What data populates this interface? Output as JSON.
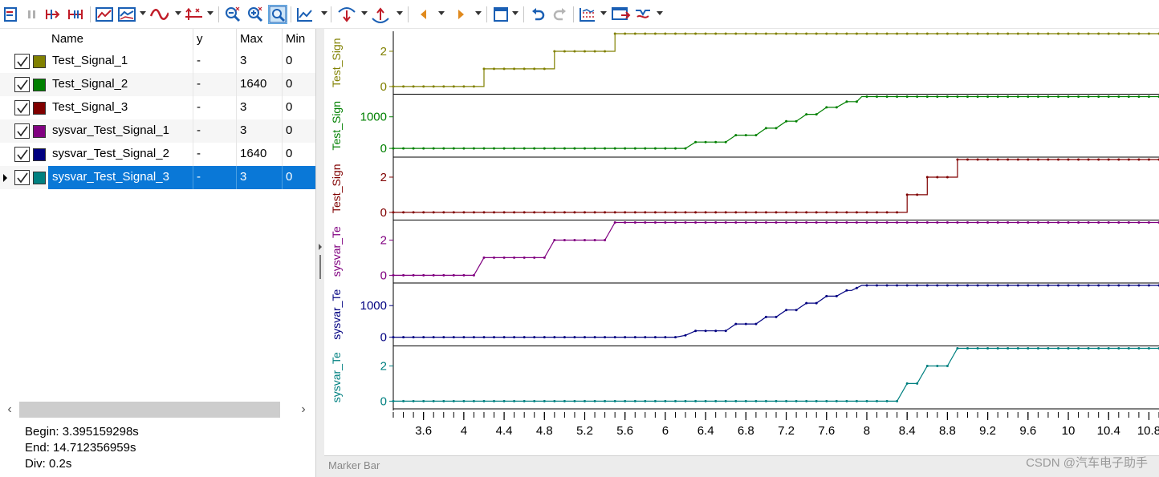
{
  "toolbar": {
    "icons": [
      "signal-list-icon",
      "pause-icon",
      "cursor-left-icon",
      "cursor-both-icon",
      "chart-view-icon",
      "chart-style-icon",
      "wave-icon",
      "axis-xy-icon",
      "zoom-out-icon",
      "zoom-in-icon",
      "zoom-fit-icon",
      "line-chart-icon",
      "step-up-icon",
      "step-down-icon",
      "prev-marker-icon",
      "next-marker-icon",
      "window-icon",
      "undo-icon",
      "redo-icon",
      "measure-icon",
      "export-icon",
      "sync-icon"
    ]
  },
  "grid": {
    "headers": {
      "name": "Name",
      "y": "y",
      "max": "Max",
      "min": "Min"
    },
    "rows": [
      {
        "name": "Test_Signal_1",
        "y": "-",
        "max": "3",
        "min": "0",
        "color": "#808000",
        "checked": true
      },
      {
        "name": "Test_Signal_2",
        "y": "-",
        "max": "1640",
        "min": "0",
        "color": "#008000",
        "checked": true
      },
      {
        "name": "Test_Signal_3",
        "y": "-",
        "max": "3",
        "min": "0",
        "color": "#800000",
        "checked": true
      },
      {
        "name": "sysvar_Test_Signal_1",
        "y": "-",
        "max": "3",
        "min": "0",
        "color": "#800080",
        "checked": true
      },
      {
        "name": "sysvar_Test_Signal_2",
        "y": "-",
        "max": "1640",
        "min": "0",
        "color": "#000080",
        "checked": true
      },
      {
        "name": "sysvar_Test_Signal_3",
        "y": "-",
        "max": "3",
        "min": "0",
        "color": "#008080",
        "checked": true,
        "selected": true
      }
    ]
  },
  "info": {
    "begin": "Begin: 3.395159298s",
    "end": "End: 14.712356959s",
    "div": "Div: 0.2s"
  },
  "marker_bar": "Marker Bar",
  "watermark": "CSDN @汽车电子助手",
  "chart_data": {
    "type": "line",
    "step": true,
    "x_range": [
      3.3,
      10.9
    ],
    "x_ticks": [
      "3.6",
      "4",
      "4.4",
      "4.8",
      "5.2",
      "5.6",
      "6",
      "6.4",
      "6.8",
      "7.2",
      "7.6",
      "8",
      "8.4",
      "8.8",
      "9.2",
      "9.6",
      "10",
      "10.4",
      "10.8"
    ],
    "x_tick_values": [
      3.6,
      4,
      4.4,
      4.8,
      5.2,
      5.6,
      6,
      6.4,
      6.8,
      7.2,
      7.6,
      8,
      8.4,
      8.8,
      9.2,
      9.6,
      10,
      10.4,
      10.8
    ],
    "sample_step": 0.1,
    "panels": [
      {
        "label": "Test_Sign",
        "color": "#808000",
        "ylim": [
          -0.3,
          3
        ],
        "y_ticks": [
          "0",
          "2"
        ],
        "y_tick_values": [
          0,
          2
        ],
        "interp": "step",
        "points": [
          [
            3.3,
            0
          ],
          [
            4.2,
            0
          ],
          [
            4.2,
            1
          ],
          [
            4.9,
            1
          ],
          [
            4.9,
            2
          ],
          [
            5.5,
            2
          ],
          [
            5.5,
            3
          ],
          [
            10.9,
            3
          ]
        ]
      },
      {
        "label": "Test_Sign",
        "color": "#008000",
        "ylim": [
          -200,
          1640
        ],
        "y_ticks": [
          "0",
          "1000"
        ],
        "y_tick_values": [
          0,
          1000
        ],
        "interp": "step",
        "points": [
          [
            3.3,
            0
          ],
          [
            6.2,
            0
          ],
          [
            6.3,
            200
          ],
          [
            6.6,
            200
          ],
          [
            6.7,
            420
          ],
          [
            6.9,
            420
          ],
          [
            7.0,
            640
          ],
          [
            7.1,
            640
          ],
          [
            7.2,
            860
          ],
          [
            7.3,
            860
          ],
          [
            7.4,
            1080
          ],
          [
            7.5,
            1080
          ],
          [
            7.6,
            1300
          ],
          [
            7.7,
            1300
          ],
          [
            7.8,
            1480
          ],
          [
            7.9,
            1480
          ],
          [
            7.95,
            1640
          ],
          [
            10.9,
            1640
          ]
        ]
      },
      {
        "label": "Test_Sign",
        "color": "#800000",
        "ylim": [
          -0.3,
          3
        ],
        "y_ticks": [
          "0",
          "2"
        ],
        "y_tick_values": [
          0,
          2
        ],
        "interp": "step",
        "points": [
          [
            3.3,
            0
          ],
          [
            8.4,
            0
          ],
          [
            8.4,
            1
          ],
          [
            8.6,
            1
          ],
          [
            8.6,
            2
          ],
          [
            8.9,
            2
          ],
          [
            8.9,
            3
          ],
          [
            10.9,
            3
          ]
        ]
      },
      {
        "label": "sysvar_Te",
        "color": "#800080",
        "ylim": [
          -0.3,
          3
        ],
        "y_ticks": [
          "0",
          "2"
        ],
        "y_tick_values": [
          0,
          2
        ],
        "interp": "linear",
        "points": [
          [
            3.3,
            0
          ],
          [
            4.1,
            0
          ],
          [
            4.2,
            1
          ],
          [
            4.8,
            1
          ],
          [
            4.9,
            2
          ],
          [
            5.4,
            2
          ],
          [
            5.5,
            3
          ],
          [
            10.9,
            3
          ]
        ]
      },
      {
        "label": "sysvar_Te",
        "color": "#000080",
        "ylim": [
          -200,
          1640
        ],
        "y_ticks": [
          "0",
          "1000"
        ],
        "y_tick_values": [
          0,
          1000
        ],
        "interp": "linear",
        "points": [
          [
            3.3,
            0
          ],
          [
            6.1,
            0
          ],
          [
            6.2,
            60
          ],
          [
            6.3,
            200
          ],
          [
            6.6,
            200
          ],
          [
            6.7,
            420
          ],
          [
            6.9,
            420
          ],
          [
            7.0,
            640
          ],
          [
            7.1,
            640
          ],
          [
            7.2,
            860
          ],
          [
            7.3,
            860
          ],
          [
            7.4,
            1080
          ],
          [
            7.5,
            1080
          ],
          [
            7.6,
            1300
          ],
          [
            7.7,
            1300
          ],
          [
            7.8,
            1480
          ],
          [
            7.85,
            1480
          ],
          [
            7.95,
            1640
          ],
          [
            10.9,
            1640
          ]
        ]
      },
      {
        "label": "sysvar_Te",
        "color": "#008080",
        "ylim": [
          -0.3,
          3
        ],
        "y_ticks": [
          "0",
          "2"
        ],
        "y_tick_values": [
          0,
          2
        ],
        "interp": "linear",
        "points": [
          [
            3.3,
            0
          ],
          [
            8.3,
            0
          ],
          [
            8.4,
            1
          ],
          [
            8.5,
            1
          ],
          [
            8.6,
            2
          ],
          [
            8.8,
            2
          ],
          [
            8.9,
            3
          ],
          [
            10.9,
            3
          ]
        ]
      }
    ]
  }
}
